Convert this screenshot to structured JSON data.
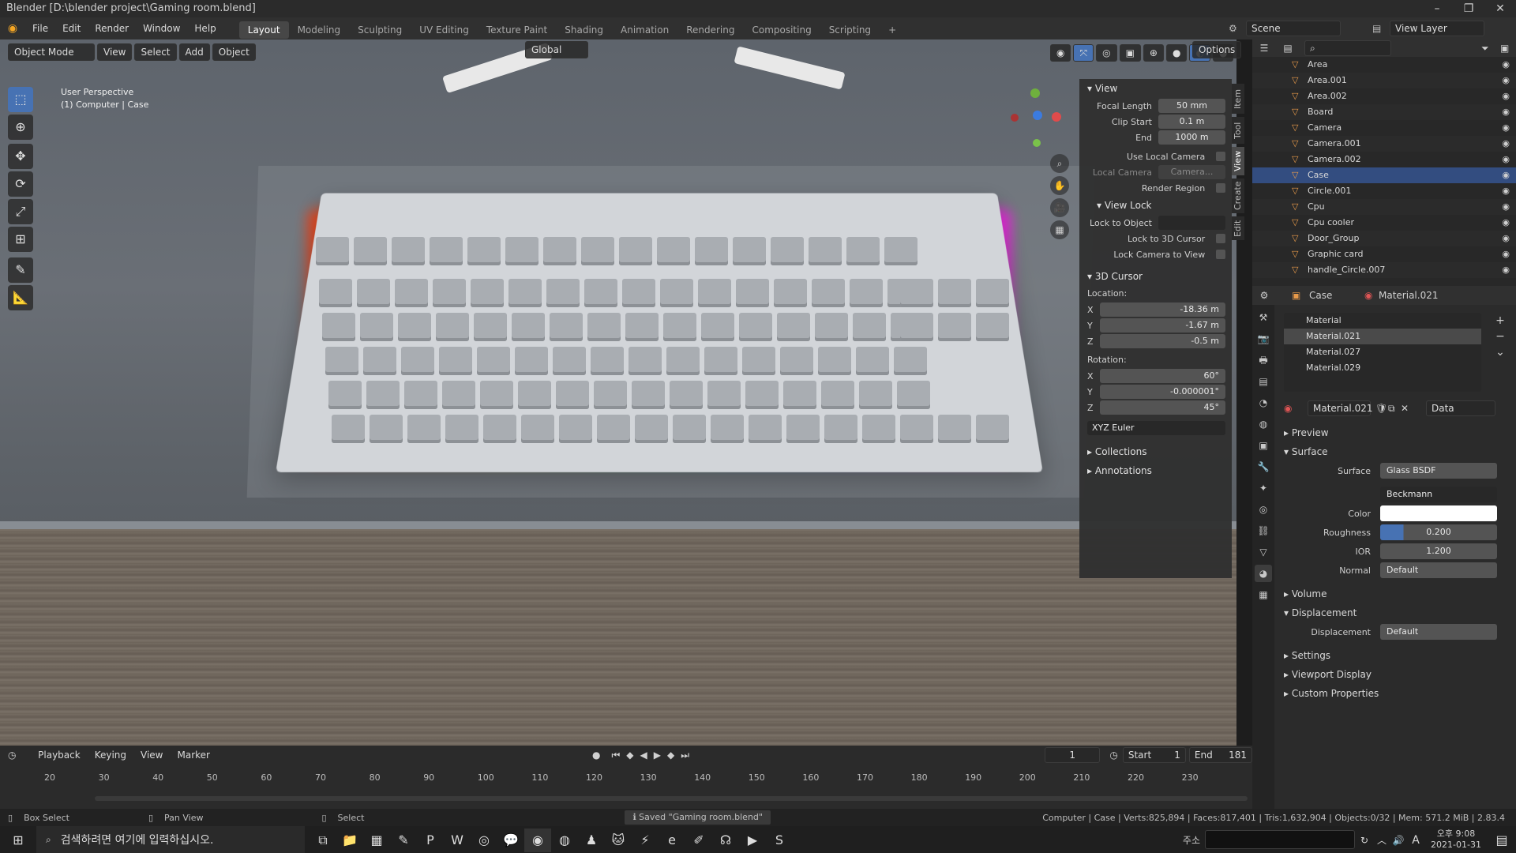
{
  "window": {
    "title": "Blender [D:\\blender project\\Gaming room.blend]",
    "min": "–",
    "max": "❐",
    "close": "✕"
  },
  "menus": [
    "File",
    "Edit",
    "Render",
    "Window",
    "Help"
  ],
  "workspaces": [
    "Layout",
    "Modeling",
    "Sculpting",
    "UV Editing",
    "Texture Paint",
    "Shading",
    "Animation",
    "Rendering",
    "Compositing",
    "Scripting"
  ],
  "scene": "Scene",
  "view_layer": "View Layer",
  "header": {
    "transform": "Global",
    "options": "Options"
  },
  "vp": {
    "mode": "Object Mode",
    "menus": [
      "View",
      "Select",
      "Add",
      "Object"
    ],
    "line1": "User Perspective",
    "line2": "(1) Computer | Case"
  },
  "npanel": {
    "view": "View",
    "focal_label": "Focal Length",
    "focal": "50 mm",
    "clip_start_label": "Clip Start",
    "clip_start": "0.1 m",
    "end_label": "End",
    "end": "1000 m",
    "use_local_cam": "Use Local Camera",
    "local_cam_label": "Local Camera",
    "local_cam": "Camera...",
    "render_region": "Render Region",
    "view_lock": "View Lock",
    "lock_obj": "Lock to Object",
    "lock_cursor": "Lock to 3D Cursor",
    "lock_cam": "Lock Camera to View",
    "cursor": "3D Cursor",
    "location": "Location:",
    "lx": "-18.36 m",
    "ly": "-1.67 m",
    "lz": "-0.5 m",
    "rotation": "Rotation:",
    "rx": "60°",
    "ry": "-0.000001°",
    "rz": "45°",
    "euler": "XYZ Euler",
    "collections": "Collections",
    "annotations": "Annotations",
    "tabs": [
      "Item",
      "Tool",
      "View",
      "Create",
      "Edit"
    ]
  },
  "outliner": [
    {
      "name": "Area"
    },
    {
      "name": "Area.001"
    },
    {
      "name": "Area.002"
    },
    {
      "name": "Board"
    },
    {
      "name": "Camera"
    },
    {
      "name": "Camera.001"
    },
    {
      "name": "Camera.002"
    },
    {
      "name": "Case"
    },
    {
      "name": "Circle.001"
    },
    {
      "name": "Cpu"
    },
    {
      "name": "Cpu cooler"
    },
    {
      "name": "Door_Group"
    },
    {
      "name": "Graphic card"
    },
    {
      "name": "handle_Circle.007"
    }
  ],
  "props": {
    "object": "Case",
    "material_name": "Material.021",
    "slots": [
      "Material",
      "Material.021",
      "Material.027",
      "Material.029"
    ],
    "data": "Data",
    "preview": "Preview",
    "surface_sec": "Surface",
    "surface_label": "Surface",
    "surface": "Glass BSDF",
    "dist": "Beckmann",
    "color_label": "Color",
    "rough_label": "Roughness",
    "rough": "0.200",
    "ior_label": "IOR",
    "ior": "1.200",
    "normal_label": "Normal",
    "normal": "Default",
    "volume": "Volume",
    "displacement_sec": "Displacement",
    "disp_label": "Displacement",
    "disp": "Default",
    "settings": "Settings",
    "viewport_display": "Viewport Display",
    "custom_props": "Custom Properties"
  },
  "timeline": {
    "menus": [
      "Playback",
      "Keying",
      "View",
      "Marker"
    ],
    "frame": "1",
    "start_label": "Start",
    "start": "1",
    "end_label": "End",
    "end": "181",
    "ticks": [
      "20",
      "30",
      "40",
      "50",
      "60",
      "70",
      "80",
      "90",
      "100",
      "110",
      "120",
      "130",
      "140",
      "150",
      "160",
      "170",
      "180",
      "190",
      "200",
      "210",
      "220",
      "230"
    ]
  },
  "status": {
    "left1": "Box Select",
    "left2": "Pan View",
    "left3": "Select",
    "msg": "Saved \"Gaming room.blend\"",
    "stats": "Computer | Case | Verts:825,894 | Faces:817,401 | Tris:1,632,904 | Objects:0/32 | Mem: 571.2 MiB | 2.83.4"
  },
  "taskbar": {
    "search": "검색하려면 여기에 입력하십시오.",
    "addr": "주소",
    "time": "오후 9:08",
    "date": "2021-01-31",
    "ime": "A"
  },
  "colors": {
    "accent": "#4772b3",
    "selected_row": "#334d80"
  }
}
